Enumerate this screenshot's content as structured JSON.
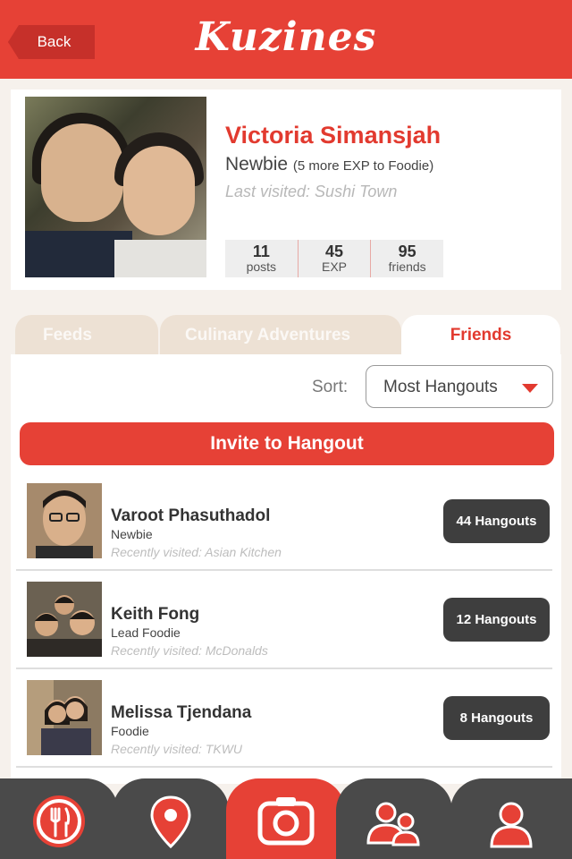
{
  "header": {
    "back_label": "Back",
    "logo_text": "Kuzines"
  },
  "profile": {
    "name": "Victoria Simansjah",
    "level": "Newbie",
    "level_note": "(5 more EXP to Foodie)",
    "last_visited": "Last visited: Sushi Town",
    "stats": [
      {
        "value": "11",
        "label": "posts"
      },
      {
        "value": "45",
        "label": "EXP"
      },
      {
        "value": "95",
        "label": "friends"
      }
    ]
  },
  "tabs": [
    {
      "label": "Feeds",
      "active": false
    },
    {
      "label": "Culinary Adventures",
      "active": false
    },
    {
      "label": "Friends",
      "active": true
    }
  ],
  "sort": {
    "label": "Sort:",
    "selected": "Most Hangouts"
  },
  "invite_label": "Invite to Hangout",
  "friends": [
    {
      "name": "Varoot Phasuthadol",
      "rank": "Newbie",
      "visited": "Recently visited: Asian Kitchen",
      "hangouts": "44 Hangouts"
    },
    {
      "name": "Keith Fong",
      "rank": "Lead Foodie",
      "visited": "Recently visited: McDonalds",
      "hangouts": "12 Hangouts"
    },
    {
      "name": "Melissa Tjendana",
      "rank": "Foodie",
      "visited": "Recently visited: TKWU",
      "hangouts": "8 Hangouts"
    }
  ],
  "bottom_nav": [
    {
      "icon": "fork-knife-icon",
      "active": false
    },
    {
      "icon": "map-pin-icon",
      "active": false
    },
    {
      "icon": "camera-icon",
      "active": true
    },
    {
      "icon": "friends-icon",
      "active": false
    },
    {
      "icon": "user-icon",
      "active": false
    }
  ],
  "colors": {
    "accent": "#e64136",
    "dark": "#3e3e3e",
    "tab_inactive": "#ede1d4"
  }
}
